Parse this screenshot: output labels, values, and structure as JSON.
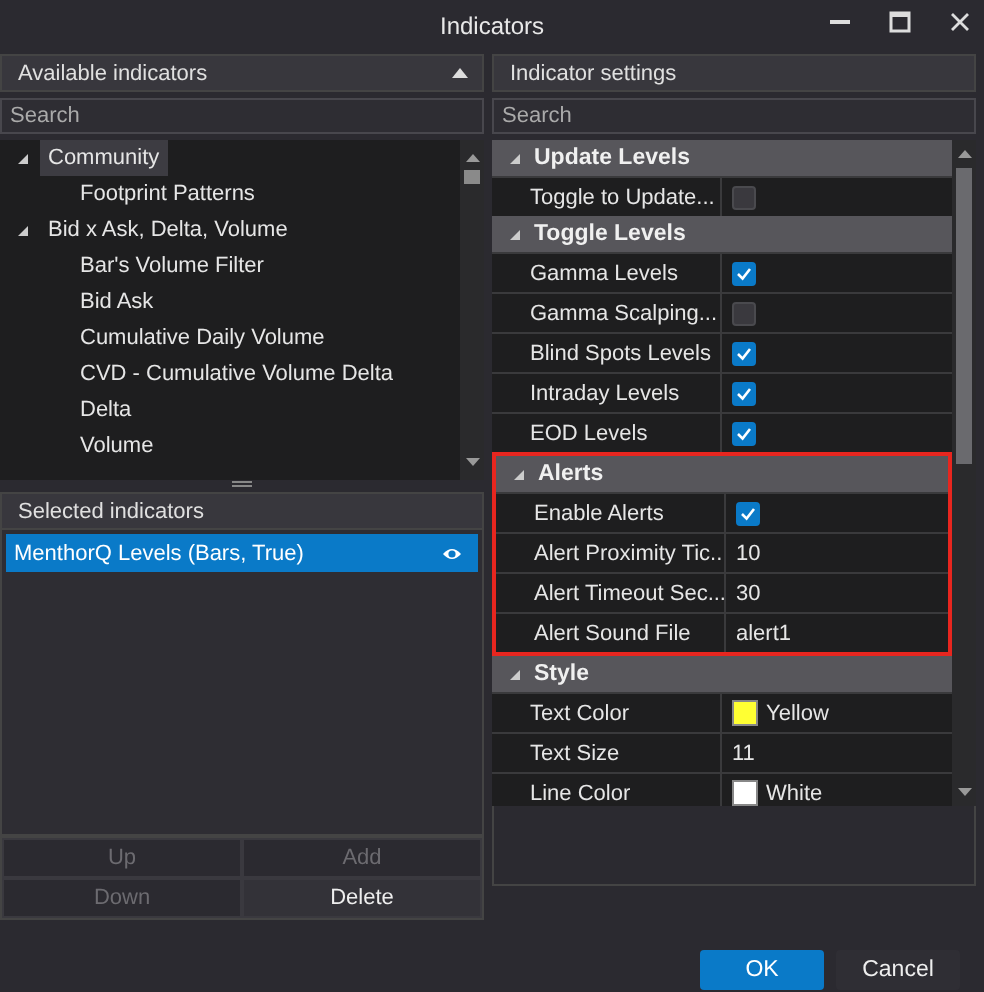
{
  "window": {
    "title": "Indicators"
  },
  "available": {
    "title": "Available indicators",
    "search_placeholder": "Search",
    "tree": [
      {
        "label": "Community",
        "expanded": true,
        "selected": true,
        "children": [
          {
            "label": "Footprint Patterns",
            "selected": false
          }
        ]
      },
      {
        "label": "Bid x Ask, Delta, Volume",
        "expanded": true,
        "selected": false,
        "children": [
          {
            "label": "Bar's Volume Filter",
            "selected": false
          },
          {
            "label": "Bid Ask",
            "selected": false
          },
          {
            "label": "Cumulative Daily Volume",
            "selected": false
          },
          {
            "label": "CVD - Cumulative Volume Delta",
            "selected": false
          },
          {
            "label": "Delta",
            "selected": false
          },
          {
            "label": "Volume",
            "selected": false
          }
        ]
      }
    ]
  },
  "selected_indicators": {
    "title": "Selected indicators",
    "items": [
      {
        "label": "MenthorQ Levels (Bars, True)",
        "selected": true,
        "visible": true
      }
    ],
    "buttons": [
      {
        "label": "Up",
        "disabled": true
      },
      {
        "label": "Add",
        "disabled": true
      },
      {
        "label": "Down",
        "disabled": true
      },
      {
        "label": "Delete",
        "disabled": false
      }
    ]
  },
  "settings": {
    "title": "Indicator settings",
    "search_placeholder": "Search",
    "groups": [
      {
        "name": "Update Levels",
        "expanded": true,
        "highlighted": false,
        "properties": [
          {
            "name": "Toggle to Update...",
            "kind": "checkbox",
            "checked": false
          }
        ]
      },
      {
        "name": "Toggle Levels",
        "expanded": true,
        "highlighted": false,
        "properties": [
          {
            "name": "Gamma Levels",
            "kind": "checkbox",
            "checked": true
          },
          {
            "name": "Gamma Scalping...",
            "kind": "checkbox",
            "checked": false
          },
          {
            "name": "Blind Spots Levels",
            "kind": "checkbox",
            "checked": true
          },
          {
            "name": "Intraday Levels",
            "kind": "checkbox",
            "checked": true
          },
          {
            "name": "EOD Levels",
            "kind": "checkbox",
            "checked": true
          }
        ]
      },
      {
        "name": "Alerts",
        "expanded": true,
        "highlighted": true,
        "properties": [
          {
            "name": "Enable Alerts",
            "kind": "checkbox",
            "checked": true
          },
          {
            "name": "Alert Proximity Tic...",
            "kind": "text",
            "value": "10"
          },
          {
            "name": "Alert Timeout Sec...",
            "kind": "text",
            "value": "30"
          },
          {
            "name": "Alert Sound File",
            "kind": "text",
            "value": "alert1"
          }
        ]
      },
      {
        "name": "Style",
        "expanded": true,
        "highlighted": false,
        "properties": [
          {
            "name": "Text Color",
            "kind": "color",
            "value": "Yellow",
            "color": "#ffff33"
          },
          {
            "name": "Text Size",
            "kind": "text",
            "value": "11"
          },
          {
            "name": "Line Color",
            "kind": "color",
            "value": "White",
            "color": "#ffffff"
          }
        ]
      }
    ]
  },
  "footer": {
    "buttons": [
      {
        "label": "OK",
        "primary": true
      },
      {
        "label": "Cancel",
        "primary": false
      }
    ]
  }
}
